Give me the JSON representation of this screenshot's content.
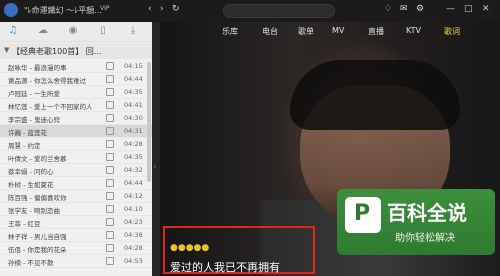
{
  "window": {
    "title": "\"ﾚ命運鐵幻  ～ﾚ平顏...",
    "vip_badge": "VIP",
    "search_placeholder": "",
    "minimize_label": "—",
    "maximize_label": "□",
    "close_label": "✕"
  },
  "top_icons": [
    "chevron-left-icon",
    "chevron-right-icon",
    "refresh-icon",
    "mic-icon",
    "shirt-icon",
    "mail-icon",
    "settings-icon"
  ],
  "left_tabs": [
    {
      "icon": "music-note-icon",
      "label": "♫",
      "active": true
    },
    {
      "icon": "cloud-icon",
      "label": "☁",
      "active": false
    },
    {
      "icon": "radio-icon",
      "label": "◉",
      "active": false
    },
    {
      "icon": "device-icon",
      "label": "▯",
      "active": false
    },
    {
      "icon": "download-icon",
      "label": "⤓",
      "active": false
    }
  ],
  "playlist": {
    "name": "【经典老歌100首】 回..."
  },
  "songs": [
    {
      "title": "赵咏华 - 最浪漫的事",
      "duration": "04:15",
      "active": false
    },
    {
      "title": "黄品源 - 你怎么舍得我难过",
      "duration": "04:44",
      "active": false
    },
    {
      "title": "卢冠廷 - 一生所爱",
      "duration": "04:35",
      "active": false
    },
    {
      "title": "林忆莲 - 爱上一个不回家的人",
      "duration": "04:41",
      "active": false
    },
    {
      "title": "李宗盛 - 鬼迷心窍",
      "duration": "04:30",
      "active": false
    },
    {
      "title": "许巍 - 蓝莲花",
      "duration": "04:31",
      "active": true
    },
    {
      "title": "周慧 - 约定",
      "duration": "04:28",
      "active": false
    },
    {
      "title": "叶倩文 - 爱的兰舍慕",
      "duration": "04:35",
      "active": false
    },
    {
      "title": "蔡幸娟 - 问的心",
      "duration": "04:32",
      "active": false
    },
    {
      "title": "朴树 - 生如夏花",
      "duration": "04:44",
      "active": false
    },
    {
      "title": "陈百强 - 偏偏喜欢你",
      "duration": "04:12",
      "active": false
    },
    {
      "title": "张学友 - 吻别恋曲",
      "duration": "04:10",
      "active": false
    },
    {
      "title": "王菲 - 红豆",
      "duration": "04:23",
      "active": false
    },
    {
      "title": "林子祥 - 男儿当自强",
      "duration": "04:38",
      "active": false
    },
    {
      "title": "伍佰 - 你是我的花朵",
      "duration": "04:28",
      "active": false
    },
    {
      "title": "孙楠 - 不见不散",
      "duration": "04:53",
      "active": false
    }
  ],
  "nav": [
    {
      "label": "乐库",
      "active": false
    },
    {
      "label": "电台",
      "active": false
    },
    {
      "label": "歌单",
      "active": false
    },
    {
      "label": "MV",
      "active": false
    },
    {
      "label": "直播",
      "active": false
    },
    {
      "label": "KTV",
      "active": false
    },
    {
      "label": "歌词",
      "active": true
    }
  ],
  "lyrics": {
    "dots": "●●●●●",
    "line": "爱过的人我已不再拥有"
  },
  "watermark": {
    "big": "百科全说",
    "small": "助你轻松解决",
    "logo_char": "P",
    "color": "#2f7a32"
  },
  "colors": {
    "accent": "#2a8fe0",
    "nav_active": "#ffd247",
    "highlight_box": "#e0251b"
  }
}
